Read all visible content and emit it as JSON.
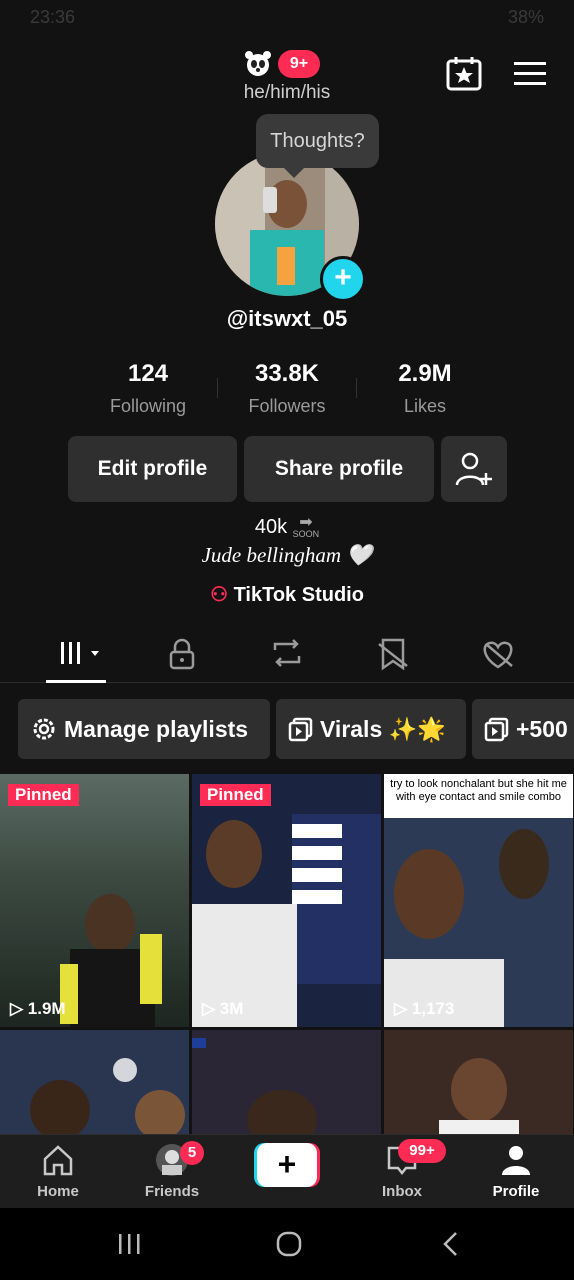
{
  "status_bar": {
    "time": "23:36",
    "battery": "38%"
  },
  "header": {
    "pronouns": "he/him/his",
    "notif_badge": "9+"
  },
  "profile": {
    "bubble": "Thoughts?",
    "handle": "@itswxt_05",
    "stats": [
      {
        "value": "124",
        "label": "Following"
      },
      {
        "value": "33.8K",
        "label": "Followers"
      },
      {
        "value": "2.9M",
        "label": "Likes"
      }
    ],
    "buttons": {
      "edit": "Edit profile",
      "share": "Share profile"
    },
    "bio_line1": "40k",
    "bio_soon": "SOON",
    "bio_line2": "Jude bellingham 🤍",
    "studio": "TikTok Studio"
  },
  "playlists": {
    "manage": "Manage playlists",
    "virals": "Virals ✨🌟",
    "third": "+500"
  },
  "videos": [
    {
      "pinned": "Pinned",
      "views": "1.9M"
    },
    {
      "pinned": "Pinned",
      "views": "3M"
    },
    {
      "caption": "try to look nonchalant but she hit me with eye contact and smile combo",
      "views": "1,173"
    }
  ],
  "bottom_nav": {
    "home": "Home",
    "friends": "Friends",
    "friends_badge": "5",
    "inbox": "Inbox",
    "inbox_badge": "99+",
    "profile": "Profile"
  }
}
